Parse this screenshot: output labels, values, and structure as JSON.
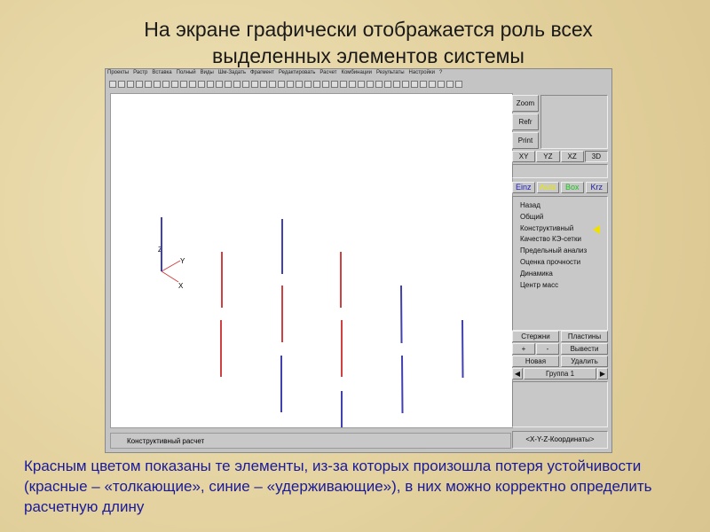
{
  "slide": {
    "title_line1": "На экране графически отображается роль всех",
    "title_line2": "выделенных элементов системы",
    "caption": "Красным цветом показаны те элементы, из-за которых произошла потеря устойчивости (красные – «толкающие», синие – «удерживающие»), в них можно корректно определить расчетную длину"
  },
  "app": {
    "menu": [
      "Проекты",
      "Растр",
      "Вставка",
      "Полный",
      "Виды",
      "Шм-Задать",
      "Фрагмент",
      "Редактировать",
      "Расчет",
      "Комбинации",
      "Результаты",
      "Настройки",
      "?"
    ],
    "status_text": "Конструктивный расчет",
    "coords_label": "<X-Y-Z-Координаты>",
    "side": {
      "zoom": "Zoom",
      "refr": "Refr",
      "print": "Print",
      "views": [
        "XY",
        "YZ",
        "XZ",
        "3D"
      ],
      "modes": [
        {
          "label": "Einz",
          "color": "#2020c0"
        },
        {
          "label": "Auto",
          "color": "#e8e800"
        },
        {
          "label": "Box",
          "color": "#20c020"
        },
        {
          "label": "Krz",
          "color": "#2020a0"
        }
      ],
      "menu_items": [
        "Назад",
        "Общий",
        "Конструктивный",
        "Качество КЭ-сетки",
        "Предельный анализ",
        "Оценка прочности",
        "Динамика",
        "Центр масс"
      ],
      "selected_item": "Конструктивный",
      "rods": "Стержни",
      "plates": "Пластины",
      "plus": "+",
      "minus": "-",
      "output": "Вывести",
      "new": "Новая",
      "delete": "Удалить",
      "group": "Группа 1"
    },
    "axes": {
      "x": "X",
      "y": "Y",
      "z": "Z"
    },
    "colors": {
      "pushing": "#d04040",
      "holding": "#4040b0"
    }
  }
}
